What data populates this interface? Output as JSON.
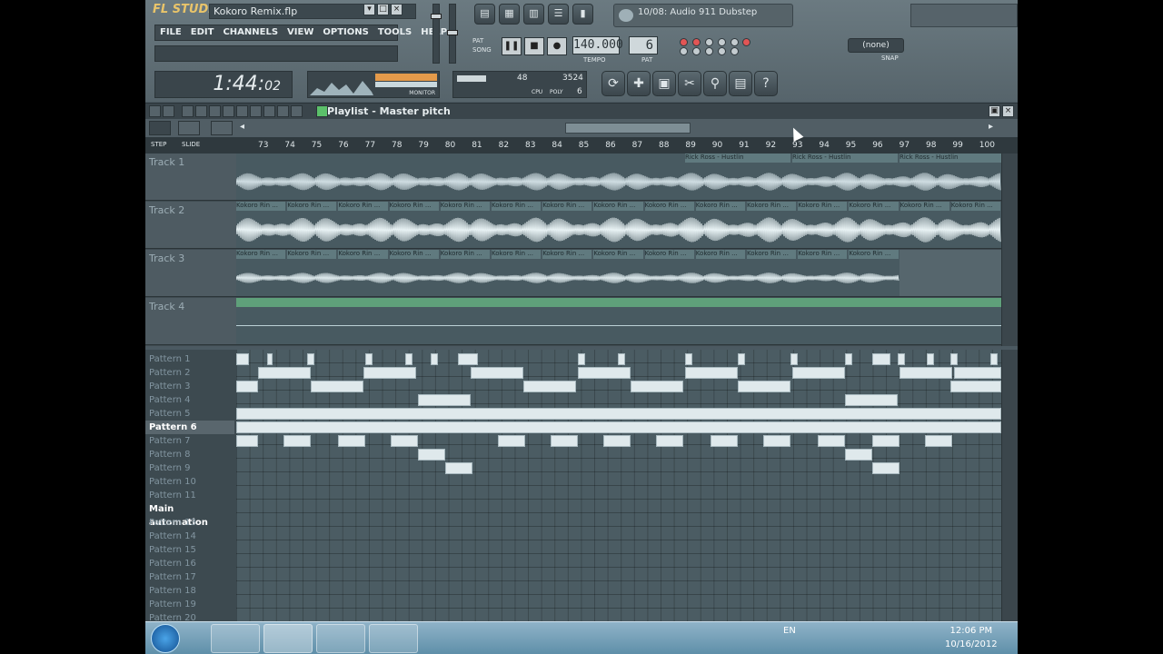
{
  "app": {
    "logo": "FL STUDIO",
    "filename": "Kokoro Remix.flp"
  },
  "menu": [
    "FILE",
    "EDIT",
    "CHANNELS",
    "VIEW",
    "OPTIONS",
    "TOOLS",
    "HELP"
  ],
  "news": {
    "text": "10/08: Audio 911 Dubstep"
  },
  "transport": {
    "pat_label": "PAT",
    "song_label": "SONG",
    "tempo": "140.000",
    "tempo_label": "TEMPO",
    "pattern_num": "6",
    "pat_num_label": "PAT",
    "snap": "(none)",
    "snap_label": "SNAP"
  },
  "clock": {
    "main": "1:44:",
    "small": "02",
    "label_bottom": "MONITOR"
  },
  "cpu": {
    "value1": "48",
    "value2": "3524",
    "label_cpu": "CPU",
    "label_poly": "POLY",
    "poly": "6"
  },
  "playlist": {
    "title": "Playlist - Master pitch",
    "step_label": "STEP",
    "slide_label": "SLIDE",
    "ruler": [
      "73",
      "74",
      "75",
      "76",
      "77",
      "78",
      "79",
      "80",
      "81",
      "82",
      "83",
      "84",
      "85",
      "86",
      "87",
      "88",
      "89",
      "90",
      "91",
      "92",
      "93",
      "94",
      "95",
      "96",
      "97",
      "98",
      "99",
      "100"
    ],
    "tracks": [
      {
        "name": "Track 1",
        "clips": [
          "Rick Ross - Hustlin",
          "Rick Ross - Hustlin",
          "Rick Ross - Hustlin"
        ]
      },
      {
        "name": "Track 2",
        "clip_label": "Kokoro Rin ..."
      },
      {
        "name": "Track 3",
        "clip_label": "Kokoro Rin ..."
      },
      {
        "name": "Track 4"
      }
    ]
  },
  "patterns": [
    "Pattern 1",
    "Pattern 2",
    "Pattern 3",
    "Pattern 4",
    "Pattern 5",
    "Pattern 6",
    "Pattern 7",
    "Pattern 8",
    "Pattern 9",
    "Pattern 10",
    "Pattern 11",
    "Main automation",
    "Pattern 13",
    "Pattern 14",
    "Pattern 15",
    "Pattern 16",
    "Pattern 17",
    "Pattern 18",
    "Pattern 19",
    "Pattern 20"
  ],
  "taskbar": {
    "lang": "EN",
    "time": "12:06 PM",
    "date": "10/16/2012"
  },
  "colors": {
    "bg": "#4b5961",
    "accent": "#e9c46a",
    "clip": "#dfe9ec",
    "record": "#e25555"
  }
}
